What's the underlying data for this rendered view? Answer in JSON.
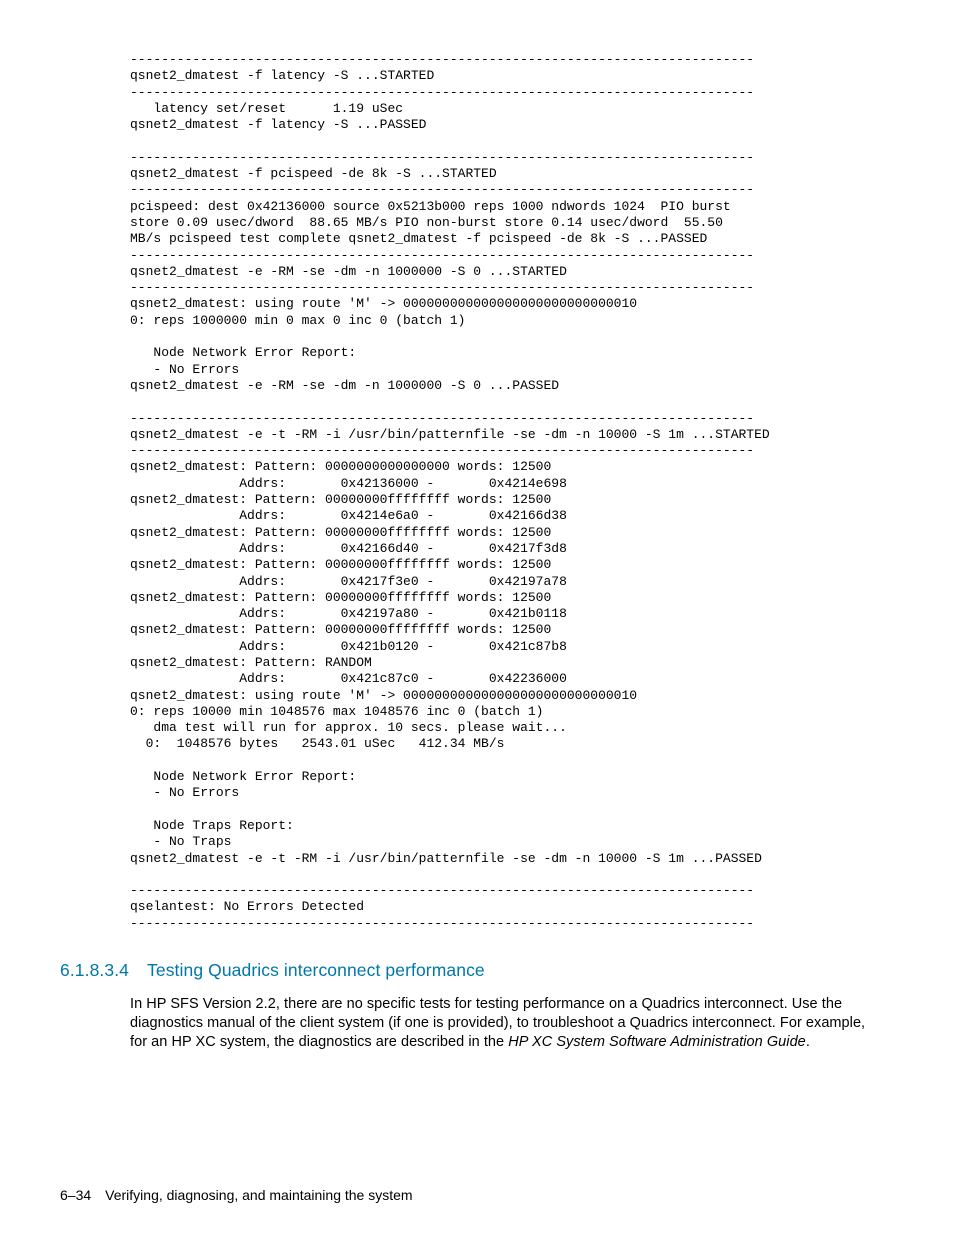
{
  "terminal": {
    "text": "--------------------------------------------------------------------------------\nqsnet2_dmatest -f latency -S ...STARTED\n--------------------------------------------------------------------------------\n   latency set/reset      1.19 uSec\nqsnet2_dmatest -f latency -S ...PASSED\n\n--------------------------------------------------------------------------------\nqsnet2_dmatest -f pcispeed -de 8k -S ...STARTED\n--------------------------------------------------------------------------------\npcispeed: dest 0x42136000 source 0x5213b000 reps 1000 ndwords 1024  PIO burst\nstore 0.09 usec/dword  88.65 MB/s PIO non-burst store 0.14 usec/dword  55.50\nMB/s pcispeed test complete qsnet2_dmatest -f pcispeed -de 8k -S ...PASSED\n--------------------------------------------------------------------------------\nqsnet2_dmatest -e -RM -se -dm -n 1000000 -S 0 ...STARTED\n--------------------------------------------------------------------------------\nqsnet2_dmatest: using route 'M' -> 000000000000000000000000000010\n0: reps 1000000 min 0 max 0 inc 0 (batch 1)\n\n   Node Network Error Report:\n   - No Errors\nqsnet2_dmatest -e -RM -se -dm -n 1000000 -S 0 ...PASSED\n\n--------------------------------------------------------------------------------\nqsnet2_dmatest -e -t -RM -i /usr/bin/patternfile -se -dm -n 10000 -S 1m ...STARTED\n--------------------------------------------------------------------------------\nqsnet2_dmatest: Pattern: 0000000000000000 words: 12500\n              Addrs:       0x42136000 -       0x4214e698\nqsnet2_dmatest: Pattern: 00000000ffffffff words: 12500\n              Addrs:       0x4214e6a0 -       0x42166d38\nqsnet2_dmatest: Pattern: 00000000ffffffff words: 12500\n              Addrs:       0x42166d40 -       0x4217f3d8\nqsnet2_dmatest: Pattern: 00000000ffffffff words: 12500\n              Addrs:       0x4217f3e0 -       0x42197a78\nqsnet2_dmatest: Pattern: 00000000ffffffff words: 12500\n              Addrs:       0x42197a80 -       0x421b0118\nqsnet2_dmatest: Pattern: 00000000ffffffff words: 12500\n              Addrs:       0x421b0120 -       0x421c87b8\nqsnet2_dmatest: Pattern: RANDOM\n              Addrs:       0x421c87c0 -       0x42236000\nqsnet2_dmatest: using route 'M' -> 000000000000000000000000000010\n0: reps 10000 min 1048576 max 1048576 inc 0 (batch 1)\n   dma test will run for approx. 10 secs. please wait...\n  0:  1048576 bytes   2543.01 uSec   412.34 MB/s\n\n   Node Network Error Report:\n   - No Errors\n\n   Node Traps Report:\n   - No Traps\nqsnet2_dmatest -e -t -RM -i /usr/bin/patternfile -se -dm -n 10000 -S 1m ...PASSED\n\n--------------------------------------------------------------------------------\nqselantest: No Errors Detected\n--------------------------------------------------------------------------------"
  },
  "section": {
    "number": "6.1.8.3.4",
    "title": "Testing Quadrics interconnect performance"
  },
  "paragraph": {
    "prefix": "In HP SFS Version 2.2, there are no specific tests for testing performance on a Quadrics interconnect. Use the diagnostics manual of the client system (if one is provided), to troubleshoot a Quadrics interconnect. For example, for an HP XC system, the diagnostics are described in the ",
    "ital": "HP XC System Software Administration Guide",
    "suffix": "."
  },
  "footer": {
    "page": "6–34",
    "text": "Verifying, diagnosing, and maintaining the system"
  }
}
